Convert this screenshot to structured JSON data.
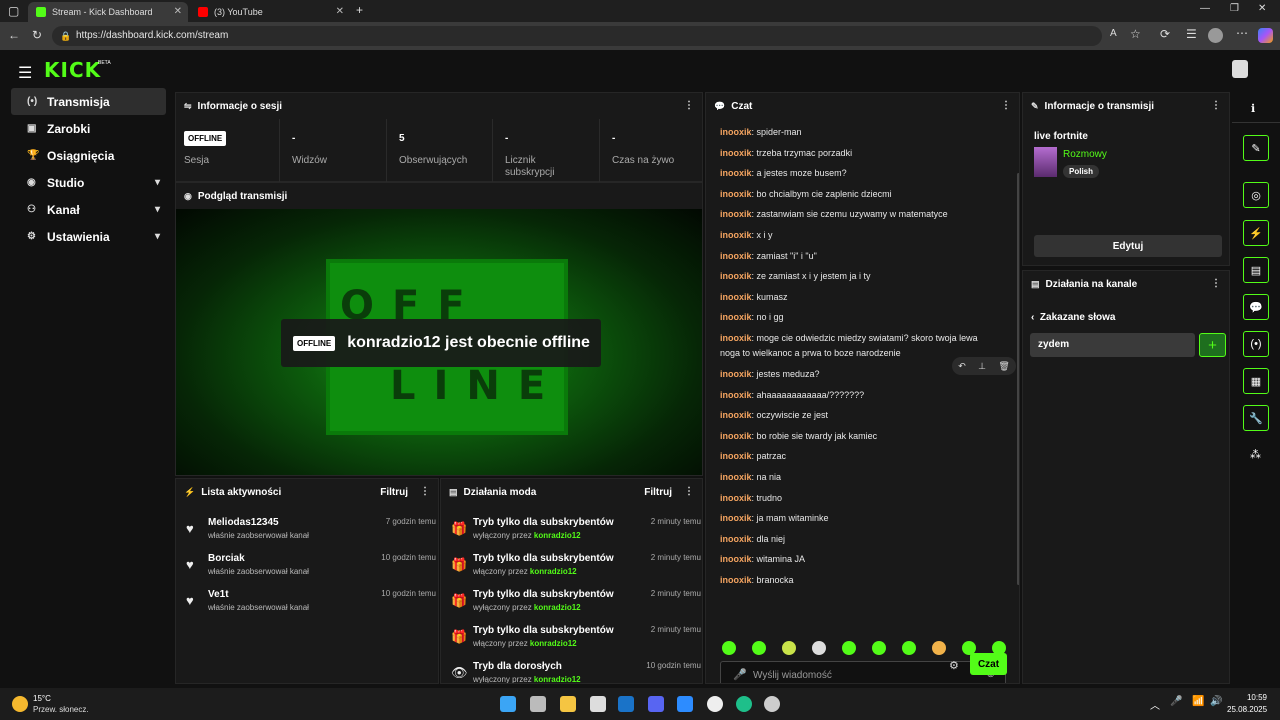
{
  "browser": {
    "tabs": [
      {
        "label": "Stream - Kick Dashboard",
        "active": true
      },
      {
        "label": "(3) YouTube",
        "active": false
      }
    ],
    "url": "https://dashboard.kick.com/stream"
  },
  "app": {
    "logo": "KICK",
    "logo_tag": "BETA",
    "nav": [
      {
        "label": "Transmisja",
        "icon": "broadcast-icon",
        "active": true
      },
      {
        "label": "Zarobki",
        "icon": "earnings-icon"
      },
      {
        "label": "Osiągnięcia",
        "icon": "trophy-icon"
      },
      {
        "label": "Studio",
        "icon": "studio-icon",
        "expandable": true
      },
      {
        "label": "Kanał",
        "icon": "channel-icon",
        "expandable": true
      },
      {
        "label": "Ustawienia",
        "icon": "gear-icon",
        "expandable": true
      }
    ]
  },
  "session": {
    "title": "Informacje o sesji",
    "status": "OFFLINE",
    "stats": [
      {
        "value": "",
        "label": "Sesja"
      },
      {
        "value": "-",
        "label": "Widzów"
      },
      {
        "value": "5",
        "label": "Obserwujących"
      },
      {
        "value": "-",
        "label": "Licznik subskrypcji"
      },
      {
        "value": "-",
        "label": "Czas na żywo"
      }
    ]
  },
  "preview": {
    "title": "Podgląd transmisji",
    "badge": "OFFLINE",
    "message": "konradzio12 jest obecnie offline",
    "sign_top": "OFF",
    "sign_bottom": "LINE"
  },
  "activity": {
    "title": "Lista aktywności",
    "filter": "Filtruj",
    "items": [
      {
        "name": "Meliodas12345",
        "sub": "właśnie zaobserwował kanał",
        "time": "7 godzin temu"
      },
      {
        "name": "Borciak",
        "sub": "właśnie zaobserwował kanał",
        "time": "10 godzin temu"
      },
      {
        "name": "Ve1t",
        "sub": "właśnie zaobserwował kanał",
        "time": "10 godzin temu"
      }
    ]
  },
  "modactions": {
    "title": "Działania moda",
    "filter": "Filtruj",
    "items": [
      {
        "title": "Tryb tylko dla subskrybentów",
        "sub": "wyłączony przez",
        "user": "konradzio12",
        "time": "2 minuty temu"
      },
      {
        "title": "Tryb tylko dla subskrybentów",
        "sub": "włączony przez",
        "user": "konradzio12",
        "time": "2 minuty temu"
      },
      {
        "title": "Tryb tylko dla subskrybentów",
        "sub": "wyłączony przez",
        "user": "konradzio12",
        "time": "2 minuty temu"
      },
      {
        "title": "Tryb tylko dla subskrybentów",
        "sub": "włączony przez",
        "user": "konradzio12",
        "time": "2 minuty temu"
      },
      {
        "title": "Tryb dla dorosłych",
        "sub": "wyłączony przez",
        "user": "konradzio12",
        "time": "10 godzin temu"
      }
    ]
  },
  "chat": {
    "title": "Czat",
    "messages": [
      {
        "user": "inooxik",
        "text": "spider-man"
      },
      {
        "user": "inooxik",
        "text": "trzeba trzymac porzadki"
      },
      {
        "user": "inooxik",
        "text": "a jestes moze busem?"
      },
      {
        "user": "inooxik",
        "text": "bo chcialbym cie zaplenic dziecmi"
      },
      {
        "user": "inooxik",
        "text": "zastanwiam sie czemu uzywamy w matematyce"
      },
      {
        "user": "inooxik",
        "text": "x i y"
      },
      {
        "user": "inooxik",
        "text": "zamiast \"i\" i \"u\""
      },
      {
        "user": "inooxik",
        "text": "ze zamiast x i y jestem ja i ty"
      },
      {
        "user": "inooxik",
        "text": "kumasz"
      },
      {
        "user": "inooxik",
        "text": "no i gg"
      },
      {
        "user": "inooxik",
        "text": "moge cie odwiedzic miedzy swiatami? skoro twoja lewa noga to wielkanoc a prwa to boze narodzenie"
      },
      {
        "user": "inooxik",
        "text": "jestes meduza?"
      },
      {
        "user": "inooxik",
        "text": "ahaaaaaaaaaaaa/???????"
      },
      {
        "user": "inooxik",
        "text": "oczywiscie ze jest"
      },
      {
        "user": "inooxik",
        "text": "bo robie sie twardy jak kamiec"
      },
      {
        "user": "inooxik",
        "text": "patrzac"
      },
      {
        "user": "inooxik",
        "text": "na nia"
      },
      {
        "user": "inooxik",
        "text": "trudno"
      },
      {
        "user": "inooxik",
        "text": "ja mam witaminke"
      },
      {
        "user": "inooxik",
        "text": "dla niej"
      },
      {
        "user": "inooxik",
        "text": "witamina JA"
      },
      {
        "user": "inooxik",
        "text": "branocka"
      }
    ],
    "input_placeholder": "Wyślij wiadomość",
    "send_label": "Czat"
  },
  "stream_info": {
    "title": "Informacje o transmisji",
    "stream_title": "live fortnite",
    "category": "Rozmowy",
    "language": "Polish",
    "edit_label": "Edytuj"
  },
  "channel_actions": {
    "title": "Działania na kanale",
    "banned_words_label": "Zakazane słowa",
    "input_value": "zydem"
  },
  "taskbar": {
    "temp": "15°C",
    "weather": "Przew. słonecz.",
    "time": "10:59",
    "date": "25.08.2025"
  },
  "colors": {
    "accent": "#53fc18",
    "panel": "#191919",
    "username": "#f4a460"
  }
}
